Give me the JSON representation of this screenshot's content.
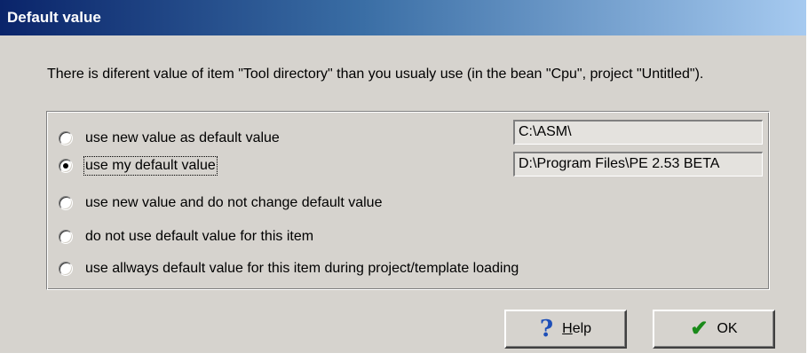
{
  "window": {
    "title": "Default value"
  },
  "message": "There is diferent value of item \"Tool directory\" than you usualy use (in the bean \"Cpu\", project \"Untitled\").",
  "options": [
    {
      "label": "use new value as default value",
      "selected": false
    },
    {
      "label": "use my default value",
      "selected": true
    },
    {
      "label": "use new value and do not change default value",
      "selected": false
    },
    {
      "label": "do not use default value for this item",
      "selected": false
    },
    {
      "label": "use allways default value for this item during project/template loading",
      "selected": false
    }
  ],
  "values": {
    "new_value": "C:\\ASM\\",
    "default_value": "D:\\Program Files\\PE 2.53 BETA"
  },
  "buttons": {
    "help_label": "Help",
    "help_icon": "help-question-icon",
    "ok_label": "OK",
    "ok_icon": "checkmark-icon"
  },
  "colors": {
    "title_start": "#0a246a",
    "title_end": "#a6caf0",
    "dialog_bg": "#d6d3ce"
  }
}
